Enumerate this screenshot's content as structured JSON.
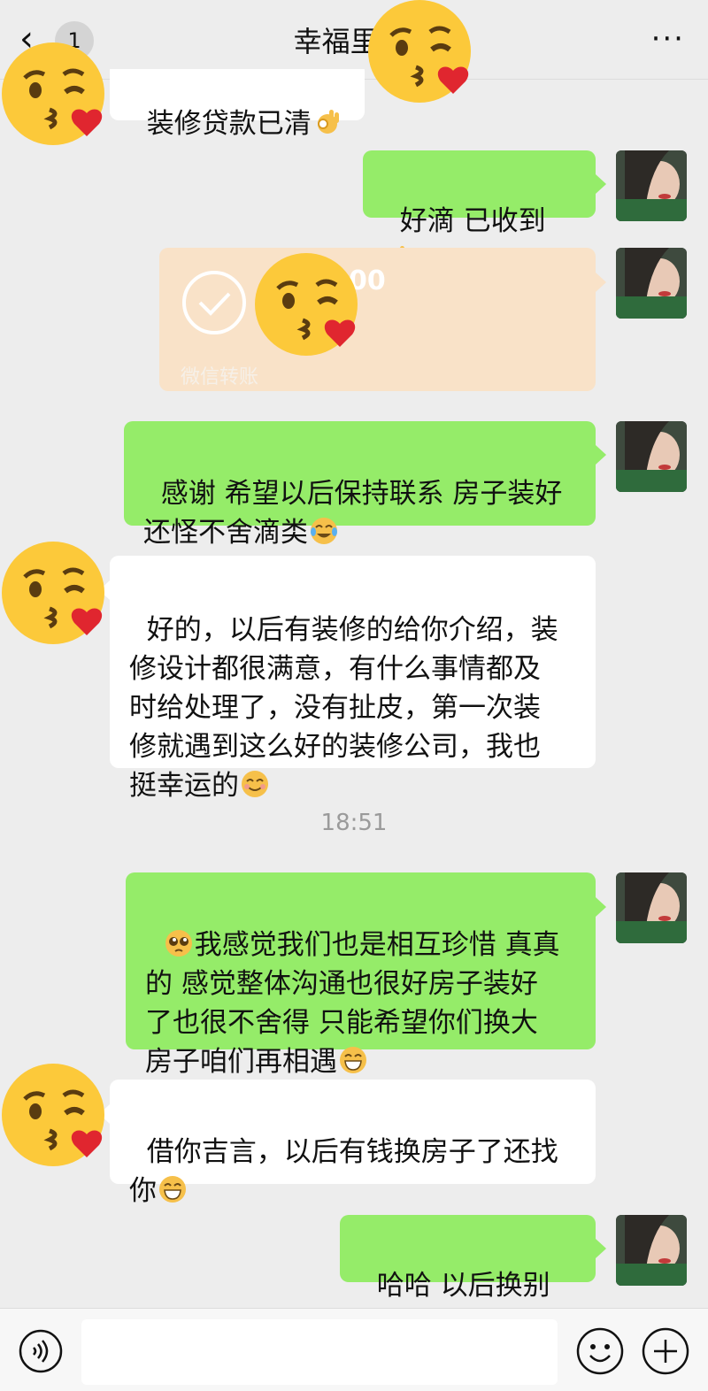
{
  "header": {
    "back_glyph": "‹",
    "unread_count": "1",
    "title": "幸福里15",
    "more_glyph": "···"
  },
  "messages": [
    {
      "side": "left",
      "text": "装修贷款已清"
    },
    {
      "side": "right",
      "text": "好滴 已收到"
    },
    {
      "side": "right",
      "type": "transfer",
      "amount_visible": "00",
      "label": "微信转账"
    },
    {
      "side": "right",
      "text": "感谢 希望以后保持联系 房子装好\n还怪不舍滴类"
    },
    {
      "side": "left",
      "text": "好的，以后有装修的给你介绍，装\n修设计都很满意，有什么事情都及\n时给处理了，没有扯皮，第一次装\n修就遇到这么好的装修公司，我也\n挺幸运的"
    },
    {
      "side": "right",
      "text": "我感觉我们也是相互珍惜 真真\n的 感觉整体沟通也很好房子装好\n了也很不舍得 只能希望你们换大\n房子咱们再相遇"
    },
    {
      "side": "left",
      "text": "借你吉言，以后有钱换房子了还找\n你"
    },
    {
      "side": "right",
      "text": "哈哈 以后换别墅"
    }
  ],
  "timestamp": "18:51",
  "icons": {
    "ok_hand": "ok-hand-emoji",
    "tears_of_joy": "tears-of-joy-emoji",
    "pleading": "pleading-emoji",
    "grin": "grin-emoji",
    "smile": "smile-emoji",
    "kiss_sticker": "kissing-heart-emoji"
  },
  "colors": {
    "bubble_green": "#95ec69",
    "bubble_white": "#ffffff",
    "transfer_bg": "#f9e2c8",
    "background": "#ededed"
  }
}
